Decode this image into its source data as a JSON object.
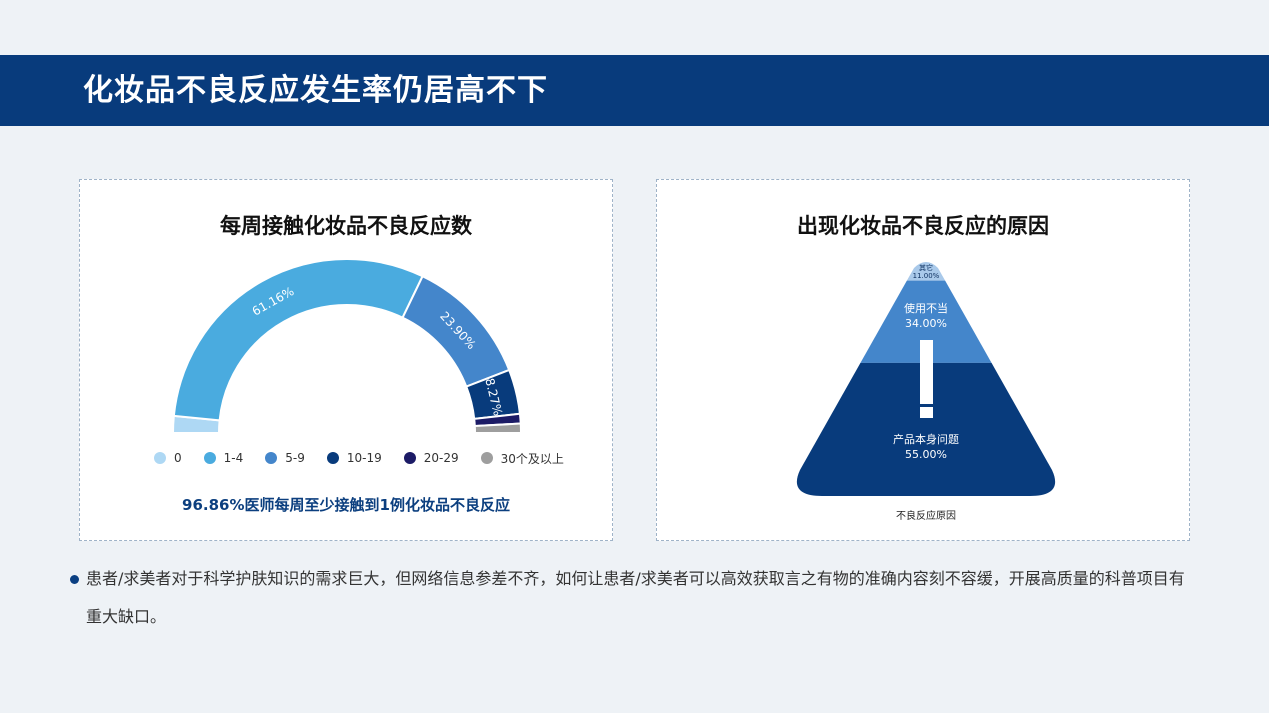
{
  "page": {
    "title": "化妆品不良反应发生率仍居高不下"
  },
  "left_panel": {
    "title": "每周接触化妆品不良反应数",
    "summary": "96.86%医师每周至少接触到1例化妆品不良反应"
  },
  "right_panel": {
    "title": "出现化妆品不良反应的原因",
    "footer": "不良反应原因"
  },
  "bullet": {
    "text": "患者/求美者对于科学护肤知识的需求巨大，但网络信息参差不齐，如何让患者/求美者可以高效获取言之有物的准确内容刻不容缓，开展高质量的科普项目有重大缺口。"
  },
  "chart_data": [
    {
      "type": "pie",
      "variant": "half-donut",
      "title": "每周接触化妆品不良反应数",
      "categories": [
        "0",
        "1-4",
        "5-9",
        "10-19",
        "20-29",
        "30个及以上"
      ],
      "values": [
        3.14,
        61.16,
        23.9,
        8.27,
        1.8,
        1.73
      ],
      "labels": [
        "",
        "61.16%",
        "23.90%",
        "8.27%",
        "",
        ""
      ],
      "colors": [
        "#aed8f4",
        "#4aabdf",
        "#4486cb",
        "#083b7c",
        "#1c1b66",
        "#9e9e9e"
      ],
      "legend": "bottom"
    },
    {
      "type": "pyramid",
      "title": "出现化妆品不良反应的原因",
      "xlabel": "不良反应原因",
      "categories": [
        "其它",
        "使用不当",
        "产品本身问题"
      ],
      "values": [
        11.0,
        34.0,
        55.0
      ],
      "value_labels": [
        "11.00%",
        "34.00%",
        "55.00%"
      ],
      "colors": [
        "#a9c9ea",
        "#4486cb",
        "#083b7c"
      ]
    }
  ]
}
